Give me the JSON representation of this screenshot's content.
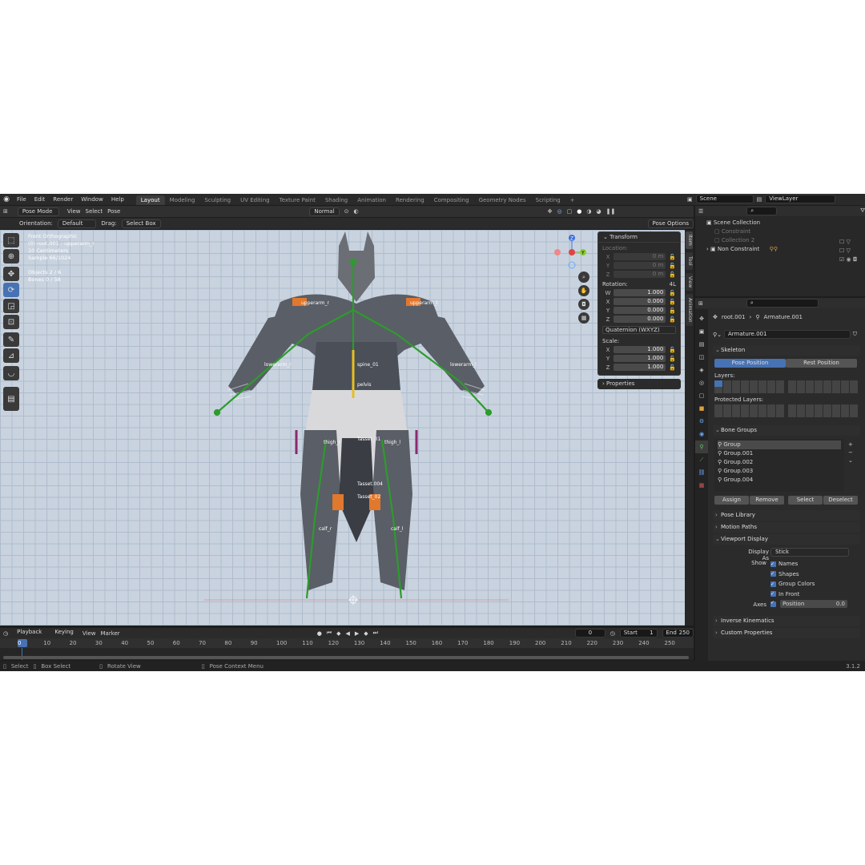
{
  "menu": [
    "File",
    "Edit",
    "Render",
    "Window",
    "Help"
  ],
  "workspaces": [
    "Layout",
    "Modeling",
    "Sculpting",
    "UV Editing",
    "Texture Paint",
    "Shading",
    "Animation",
    "Rendering",
    "Compositing",
    "Geometry Nodes",
    "Scripting",
    "+"
  ],
  "scene": "Scene",
  "view_layer": "ViewLayer",
  "header": {
    "mode": "Pose Mode",
    "view": "View",
    "select": "Select",
    "pose": "Pose",
    "pivot": "Normal"
  },
  "toolsettings": {
    "orientation_label": "Orientation:",
    "orientation": "Default",
    "drag_label": "Drag:",
    "drag": "Select Box",
    "pose_options": "Pose Options"
  },
  "overlay": {
    "l1": "Front Orthographic",
    "l2": "(0) root.001 : upperarm_r",
    "l3": "10 Centimeters",
    "l4": "Sample 66/1024",
    "l5": "Objects    2 / 6",
    "l6": "Bones      0 / 58"
  },
  "bones": [
    "upperarm_l",
    "upperarm_r",
    "lowerarm_l",
    "lowerarm_r",
    "spine_01",
    "pelvis",
    "thigh_l",
    "thigh_r",
    "calf_l",
    "calf_r",
    "Tasset_01",
    "Tasset_02",
    "Tasset.004"
  ],
  "npanel": {
    "title": "Transform",
    "location": "Location:",
    "loc": [
      "0 m",
      "0 m",
      "0 m"
    ],
    "rotation": "Rotation:",
    "rot_mode_short": "4L",
    "rot": [
      {
        "a": "W",
        "v": "1.000"
      },
      {
        "a": "X",
        "v": "0.000"
      },
      {
        "a": "Y",
        "v": "0.000"
      },
      {
        "a": "Z",
        "v": "0.000"
      }
    ],
    "rot_mode": "Quaternion (WXYZ)",
    "scale": "Scale:",
    "scl": [
      {
        "a": "X",
        "v": "1.000"
      },
      {
        "a": "Y",
        "v": "1.000"
      },
      {
        "a": "Z",
        "v": "1.000"
      }
    ],
    "properties": "Properties"
  },
  "side_tabs": [
    "Item",
    "Tool",
    "View",
    "Animation"
  ],
  "outliner": {
    "title": "Scene Collection",
    "items": [
      "Constraint",
      "Collection 2",
      "Non Constraint"
    ]
  },
  "props": {
    "breadcrumb1": "root.001",
    "breadcrumb2": "Armature.001",
    "data_name": "Armature.001",
    "skeleton": "Skeleton",
    "pose_position": "Pose Position",
    "rest_position": "Rest Position",
    "layers": "Layers:",
    "protected_layers": "Protected Layers:",
    "bone_groups": "Bone Groups",
    "groups": [
      "Group",
      "Group.001",
      "Group.002",
      "Group.003",
      "Group.004"
    ],
    "assign": "Assign",
    "remove": "Remove",
    "select": "Select",
    "deselect": "Deselect",
    "pose_library": "Pose Library",
    "motion_paths": "Motion Paths",
    "viewport_display": "Viewport Display",
    "display_as_label": "Display As",
    "display_as": "Stick",
    "show": "Show",
    "names": "Names",
    "shapes": "Shapes",
    "group_colors": "Group Colors",
    "in_front": "In Front",
    "axes": "Axes",
    "position": "Position",
    "position_val": "0.0",
    "ik": "Inverse Kinematics",
    "custom": "Custom Properties"
  },
  "timeline": {
    "playback": "Playback",
    "keying": "Keying",
    "view": "View",
    "marker": "Marker",
    "frame": "0",
    "start_label": "Start",
    "start": "1",
    "end_label": "End",
    "end": "250",
    "ticks": [
      "0",
      "10",
      "20",
      "30",
      "40",
      "50",
      "60",
      "70",
      "80",
      "90",
      "100",
      "110",
      "120",
      "130",
      "140",
      "150",
      "160",
      "170",
      "180",
      "190",
      "200",
      "210",
      "220",
      "230",
      "240",
      "250"
    ]
  },
  "status": {
    "select": "Select",
    "box_select": "Box Select",
    "rotate": "Rotate View",
    "ctx": "Pose Context Menu",
    "version": "3.1.2"
  }
}
